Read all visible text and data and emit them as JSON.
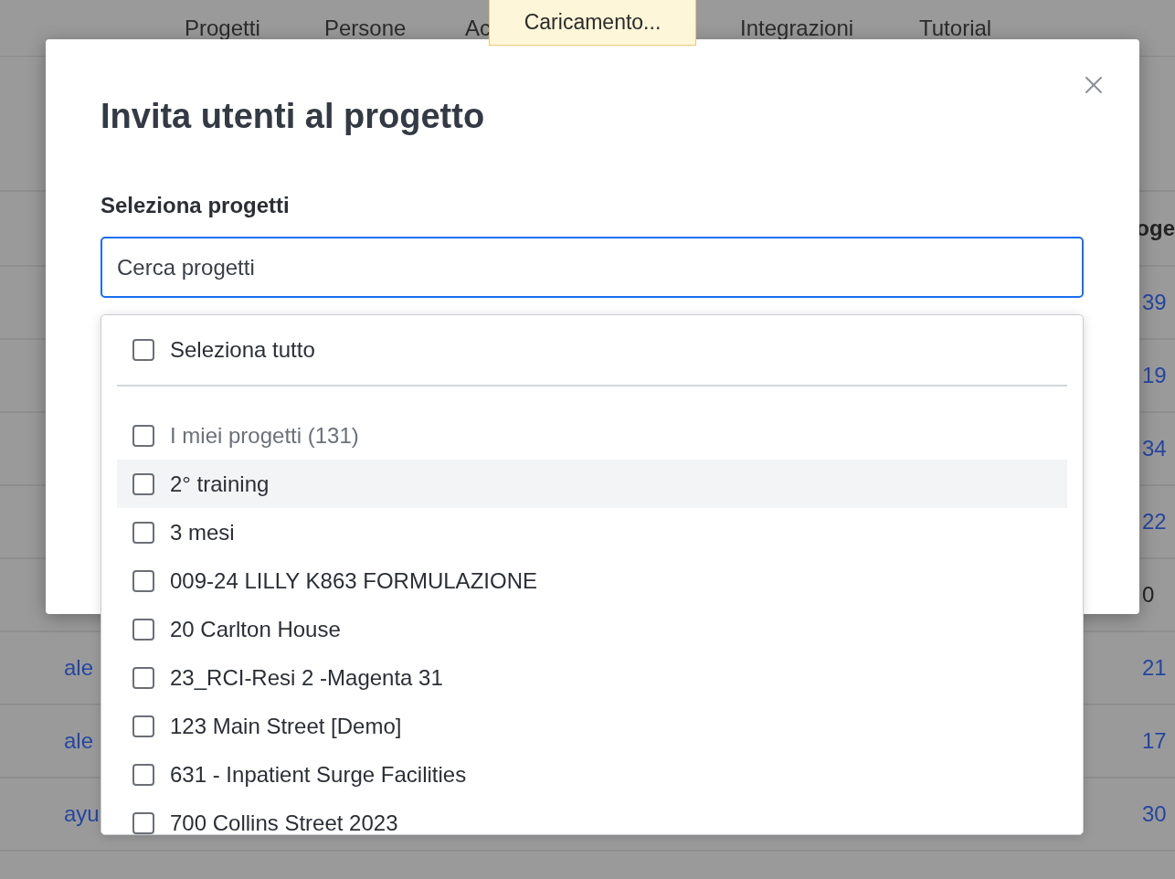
{
  "nav": [
    {
      "label": "Progetti"
    },
    {
      "label": "Persone"
    },
    {
      "label": "Ac"
    },
    {
      "label": "Integrazioni"
    },
    {
      "label": "Tutorial"
    }
  ],
  "toast": {
    "text": "Caricamento..."
  },
  "table": {
    "column_header": "oge",
    "rows": [
      {
        "value": "39",
        "kind": "link"
      },
      {
        "value": "19",
        "kind": "link"
      },
      {
        "value": "34",
        "kind": "link"
      },
      {
        "value": "22",
        "kind": "link"
      },
      {
        "value": "0",
        "kind": "plain"
      },
      {
        "name": "ale",
        "value": "21",
        "kind": "link"
      },
      {
        "name": "ale",
        "value": "17",
        "kind": "link"
      },
      {
        "name": "ayu",
        "value": "30",
        "kind": "link"
      }
    ]
  },
  "modal": {
    "title": "Invita utenti al progetto",
    "field_label": "Seleziona progetti",
    "search": {
      "placeholder": "Cerca progetti"
    },
    "select_all": {
      "label": "Seleziona tutto",
      "checked": false
    },
    "options": [
      {
        "label": "I miei progetti (131)",
        "kind": "group",
        "checked": false,
        "highlighted": false
      },
      {
        "label": "2° training",
        "kind": "project",
        "checked": false,
        "highlighted": true
      },
      {
        "label": "3 mesi",
        "kind": "project",
        "checked": false,
        "highlighted": false
      },
      {
        "label": "009-24 LILLY K863 FORMULAZIONE",
        "kind": "project",
        "checked": false,
        "highlighted": false
      },
      {
        "label": "20 Carlton House",
        "kind": "project",
        "checked": false,
        "highlighted": false
      },
      {
        "label": "23_RCI-Resi 2 -Magenta 31",
        "kind": "project",
        "checked": false,
        "highlighted": false
      },
      {
        "label": "123 Main Street [Demo]",
        "kind": "project",
        "checked": false,
        "highlighted": false
      },
      {
        "label": "631 - Inpatient Surge Facilities",
        "kind": "project",
        "checked": false,
        "highlighted": false
      },
      {
        "label": "700 Collins Street 2023",
        "kind": "project",
        "checked": false,
        "highlighted": false
      }
    ]
  }
}
